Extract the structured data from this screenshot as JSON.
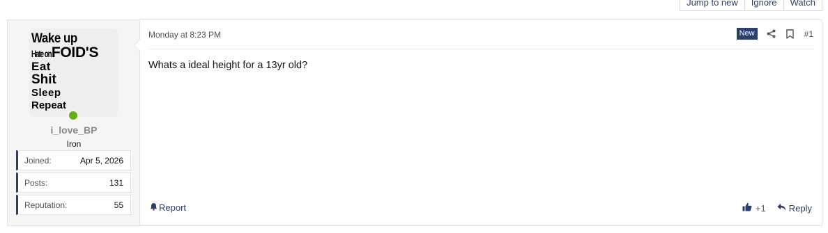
{
  "thread_actions": [
    "Jump to new",
    "Ignore",
    "Watch"
  ],
  "post": {
    "user": {
      "avatar_lines": [
        "Wake up",
        "Hate on",
        "FOID'S",
        "Eat",
        "Shit",
        "Sleep",
        "Repeat"
      ],
      "username": "i_love_BP",
      "title": "Iron",
      "online": true,
      "stats": [
        {
          "label": "Joined:",
          "value": "Apr 5, 2026"
        },
        {
          "label": "Posts:",
          "value": "131"
        },
        {
          "label": "Reputation:",
          "value": "55"
        }
      ]
    },
    "date": "Monday at 8:23 PM",
    "badge": "New",
    "post_number": "#1",
    "body": "Whats a ideal height for a 13yr old?",
    "report_label": "Report",
    "reaction_count": "+1",
    "reply_label": "Reply",
    "colors": {
      "accent": "#2b3f6b",
      "online": "#63b10f"
    },
    "icons": [
      "share-icon",
      "bookmark-icon",
      "bell-icon",
      "thumbs-up-icon",
      "reply-icon"
    ]
  }
}
